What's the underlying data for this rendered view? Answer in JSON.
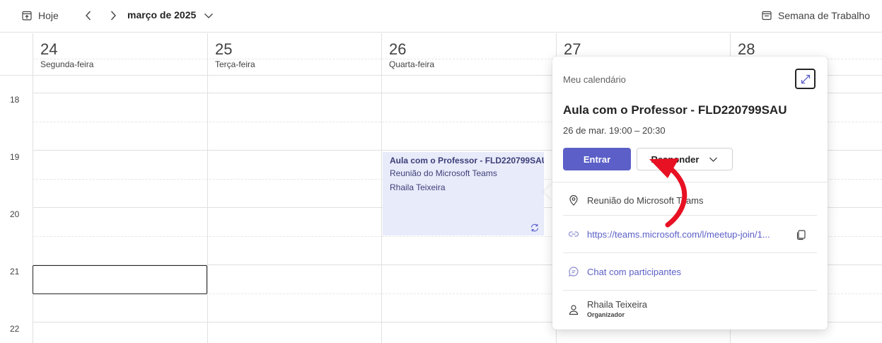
{
  "toolbar": {
    "today_label": "Hoje",
    "month_label": "março de 2025",
    "view_label": "Semana de Trabalho"
  },
  "days": [
    {
      "num": "24",
      "name": "Segunda-feira"
    },
    {
      "num": "25",
      "name": "Terça-feira"
    },
    {
      "num": "26",
      "name": "Quarta-feira"
    },
    {
      "num": "27",
      "name": ""
    },
    {
      "num": "28",
      "name": ""
    }
  ],
  "hours": [
    "18",
    "19",
    "20",
    "21",
    "22"
  ],
  "event": {
    "title": "Aula com o Professor - FLD220799SAU",
    "location": "Reunião do Microsoft Teams",
    "organizer": "Rhaila Teixeira"
  },
  "card": {
    "calendar_name": "Meu calendário",
    "title": "Aula com o Professor - FLD220799SAU",
    "time": "26 de mar. 19:00 – 20:30",
    "join_label": "Entrar",
    "respond_label": "Responder",
    "location": "Reunião do Microsoft Teams",
    "link": "https://teams.microsoft.com/l/meetup-join/1...",
    "chat_label": "Chat com participantes",
    "organizer_name": "Rhaila Teixeira",
    "organizer_role": "Organizador"
  },
  "colors": {
    "accent": "#5b5fc7",
    "event_bg": "#e8ebfa",
    "annotation_arrow": "#e81123"
  }
}
